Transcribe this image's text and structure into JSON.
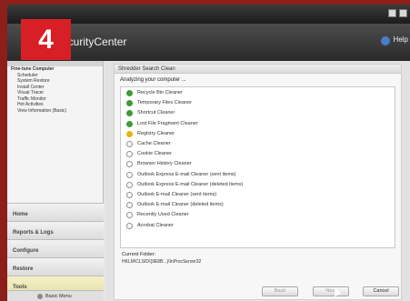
{
  "step_badge": "4",
  "app": {
    "title": "SecurityCenter",
    "help_label": "Help"
  },
  "sidebar": {
    "tree": [
      "Fine-tune Computer",
      "Scheduler",
      "System Restore",
      "Install Center",
      "Visual Tracer",
      "Traffic Monitor",
      "Hot Activities",
      "View Information (Basic)"
    ],
    "nav": [
      "Home",
      "Reports & Logs",
      "Configure",
      "Restore",
      "Tools"
    ],
    "basic_view": "Basic Menu"
  },
  "panel": {
    "title": "Shredder Search Clean",
    "status": "Analyzing your computer ...",
    "items": [
      {
        "label": "Recycle Bin Cleaner",
        "state": "done"
      },
      {
        "label": "Temporary Files Cleaner",
        "state": "done"
      },
      {
        "label": "Shortcut Cleaner",
        "state": "done"
      },
      {
        "label": "Lost File Fragment Cleaner",
        "state": "done"
      },
      {
        "label": "Registry Cleaner",
        "state": "busy"
      },
      {
        "label": "Cache Cleaner",
        "state": "pending"
      },
      {
        "label": "Cookie Cleaner",
        "state": "pending"
      },
      {
        "label": "Browser History Cleaner",
        "state": "pending"
      },
      {
        "label": "Outlook Express E-mail Cleaner (sent items)",
        "state": "pending"
      },
      {
        "label": "Outlook Express E-mail Cleaner (deleted items)",
        "state": "pending"
      },
      {
        "label": "Outlook E-mail Cleaner (sent items)",
        "state": "pending"
      },
      {
        "label": "Outlook E-mail Cleaner (deleted items)",
        "state": "pending"
      },
      {
        "label": "Recently Used Cleaner",
        "state": "pending"
      },
      {
        "label": "Acrobat Cleaner",
        "state": "pending"
      }
    ],
    "current_folder_label": "Current Folder:",
    "current_folder_path": "HKLM\\CLSID\\{9E8B...}\\InProcServer32"
  },
  "buttons": {
    "back": "Back",
    "next": "Next",
    "cancel": "Cancel"
  },
  "colors": {
    "done": "#3f9a35",
    "busy": "#e9b315",
    "badge": "#d81f26"
  }
}
